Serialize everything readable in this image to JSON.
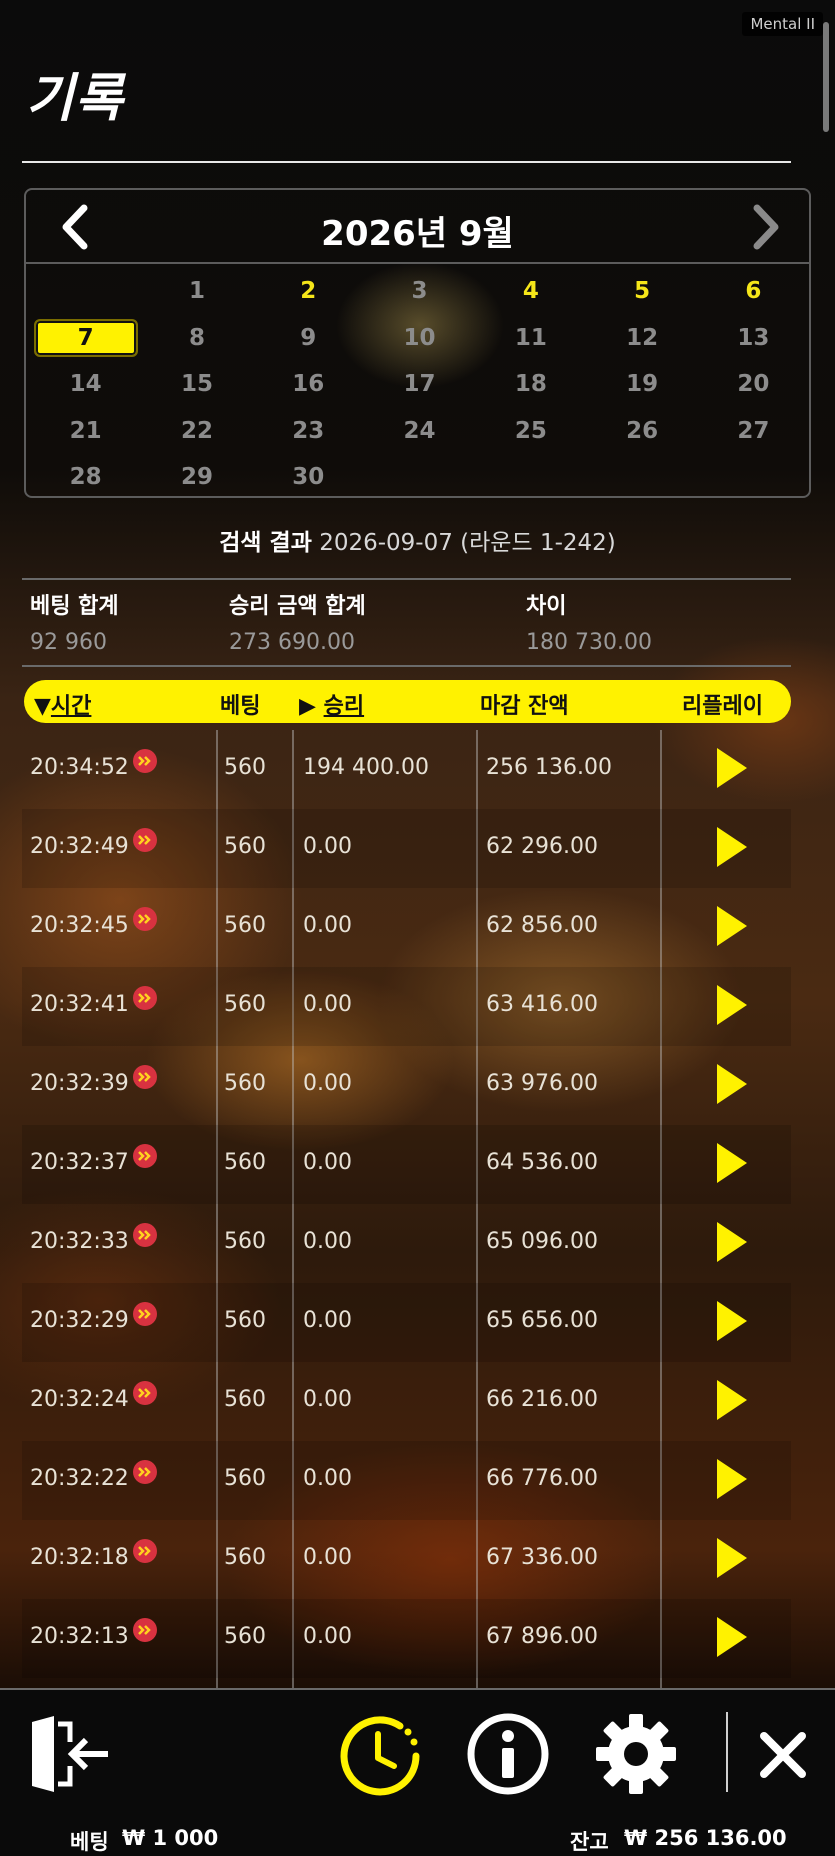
{
  "watermark": "Mental II",
  "page_title": "기록",
  "calendar": {
    "title": "2026년 9월",
    "days": [
      {
        "d": "",
        "c": ""
      },
      {
        "d": "1",
        "c": ""
      },
      {
        "d": "2",
        "c": "hl"
      },
      {
        "d": "3",
        "c": ""
      },
      {
        "d": "4",
        "c": "hl"
      },
      {
        "d": "5",
        "c": "hl"
      },
      {
        "d": "6",
        "c": "hl"
      },
      {
        "d": "7",
        "c": "sel"
      },
      {
        "d": "8",
        "c": ""
      },
      {
        "d": "9",
        "c": ""
      },
      {
        "d": "10",
        "c": ""
      },
      {
        "d": "11",
        "c": ""
      },
      {
        "d": "12",
        "c": ""
      },
      {
        "d": "13",
        "c": ""
      },
      {
        "d": "14",
        "c": ""
      },
      {
        "d": "15",
        "c": ""
      },
      {
        "d": "16",
        "c": ""
      },
      {
        "d": "17",
        "c": ""
      },
      {
        "d": "18",
        "c": ""
      },
      {
        "d": "19",
        "c": ""
      },
      {
        "d": "20",
        "c": ""
      },
      {
        "d": "21",
        "c": ""
      },
      {
        "d": "22",
        "c": ""
      },
      {
        "d": "23",
        "c": ""
      },
      {
        "d": "24",
        "c": ""
      },
      {
        "d": "25",
        "c": ""
      },
      {
        "d": "26",
        "c": ""
      },
      {
        "d": "27",
        "c": ""
      },
      {
        "d": "28",
        "c": ""
      },
      {
        "d": "29",
        "c": ""
      },
      {
        "d": "30",
        "c": ""
      }
    ]
  },
  "search": {
    "label": "검색 결과",
    "value": "2026-09-07 (라운드 1-242)"
  },
  "summary": {
    "bet_total_label": "베팅 합계",
    "bet_total": "92 960",
    "win_total_label": "승리 금액 합계",
    "win_total": "273 690.00",
    "diff_label": "차이",
    "diff": "180 730.00"
  },
  "table": {
    "headers": {
      "time": "시간",
      "bet": "베팅",
      "win": "승리",
      "balance": "마감 잔액",
      "replay": "리플레이"
    },
    "rows": [
      {
        "time": "20:34:52",
        "bet": "560",
        "win": "194 400.00",
        "balance": "256 136.00"
      },
      {
        "time": "20:32:49",
        "bet": "560",
        "win": "0.00",
        "balance": "62 296.00"
      },
      {
        "time": "20:32:45",
        "bet": "560",
        "win": "0.00",
        "balance": "62 856.00"
      },
      {
        "time": "20:32:41",
        "bet": "560",
        "win": "0.00",
        "balance": "63 416.00"
      },
      {
        "time": "20:32:39",
        "bet": "560",
        "win": "0.00",
        "balance": "63 976.00"
      },
      {
        "time": "20:32:37",
        "bet": "560",
        "win": "0.00",
        "balance": "64 536.00"
      },
      {
        "time": "20:32:33",
        "bet": "560",
        "win": "0.00",
        "balance": "65 096.00"
      },
      {
        "time": "20:32:29",
        "bet": "560",
        "win": "0.00",
        "balance": "65 656.00"
      },
      {
        "time": "20:32:24",
        "bet": "560",
        "win": "0.00",
        "balance": "66 216.00"
      },
      {
        "time": "20:32:22",
        "bet": "560",
        "win": "0.00",
        "balance": "66 776.00"
      },
      {
        "time": "20:32:18",
        "bet": "560",
        "win": "0.00",
        "balance": "67 336.00"
      },
      {
        "time": "20:32:13",
        "bet": "560",
        "win": "0.00",
        "balance": "67 896.00"
      }
    ]
  },
  "icons": {
    "exit": "exit-door-icon",
    "history": "history-clock-icon",
    "info": "info-icon",
    "settings": "gear-icon",
    "close": "close-icon"
  },
  "colors": {
    "accent": "#fff200",
    "ticket": "#d83240"
  },
  "status": {
    "bet_label": "베팅",
    "bet_value": "₩ 1 000",
    "balance_label": "잔고",
    "balance_value": "₩ 256 136.00"
  }
}
